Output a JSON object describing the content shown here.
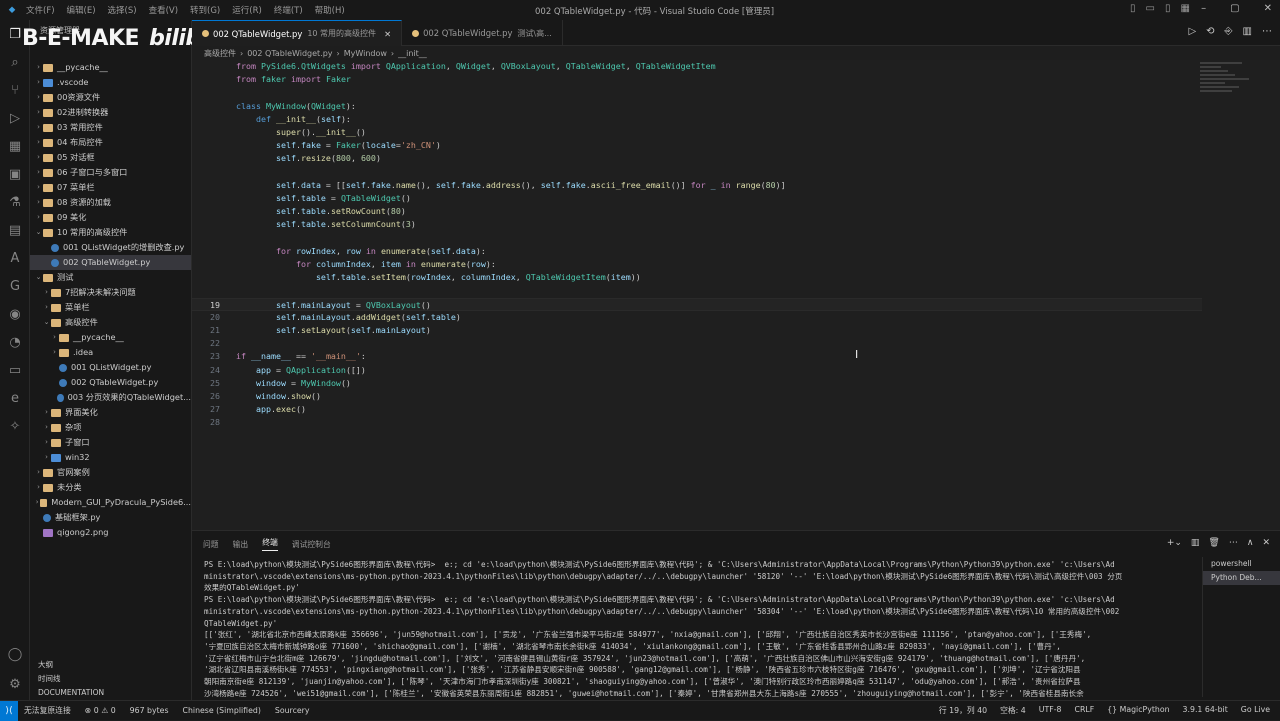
{
  "titlebar": {
    "menu": [
      "文件(F)",
      "编辑(E)",
      "选择(S)",
      "查看(V)",
      "转到(G)",
      "运行(R)",
      "终端(T)",
      "帮助(H)"
    ],
    "title": "002 QTableWidget.py - 代码 - Visual Studio Code [管理员]"
  },
  "watermark": {
    "text": "B-E-MAKE",
    "logo": "bilibili"
  },
  "sidebar": {
    "header": "资源管理器",
    "items": [
      {
        "label": "__pycache__",
        "icon": "folder",
        "depth": 1,
        "chev": "›"
      },
      {
        "label": ".vscode",
        "icon": "folder-blue",
        "depth": 1,
        "chev": "›"
      },
      {
        "label": "00资源文件",
        "icon": "folder",
        "depth": 1,
        "chev": "›"
      },
      {
        "label": "02进制转换器",
        "icon": "folder",
        "depth": 1,
        "chev": "›"
      },
      {
        "label": "03 常用控件",
        "icon": "folder",
        "depth": 1,
        "chev": "›"
      },
      {
        "label": "04 布局控件",
        "icon": "folder",
        "depth": 1,
        "chev": "›"
      },
      {
        "label": "05 对话框",
        "icon": "folder",
        "depth": 1,
        "chev": "›"
      },
      {
        "label": "06 子窗口与多窗口",
        "icon": "folder",
        "depth": 1,
        "chev": "›"
      },
      {
        "label": "07 菜单栏",
        "icon": "folder",
        "depth": 1,
        "chev": "›"
      },
      {
        "label": "08 资源的加载",
        "icon": "folder",
        "depth": 1,
        "chev": "›"
      },
      {
        "label": "09 美化",
        "icon": "folder",
        "depth": 1,
        "chev": "›"
      },
      {
        "label": "10 常用的高级控件",
        "icon": "folder",
        "depth": 1,
        "chev": "⌄"
      },
      {
        "label": "001 QListWidget的增删改查.py",
        "icon": "py",
        "depth": 2,
        "chev": ""
      },
      {
        "label": "002 QTableWidget.py",
        "icon": "py",
        "depth": 2,
        "chev": "",
        "selected": true
      },
      {
        "label": "测试",
        "icon": "folder",
        "depth": 1,
        "chev": "⌄"
      },
      {
        "label": "7招解决未解决问题",
        "icon": "folder",
        "depth": 2,
        "chev": "›"
      },
      {
        "label": "菜单栏",
        "icon": "folder",
        "depth": 2,
        "chev": "›"
      },
      {
        "label": "高级控件",
        "icon": "folder",
        "depth": 2,
        "chev": "⌄"
      },
      {
        "label": "__pycache__",
        "icon": "folder",
        "depth": 3,
        "chev": "›"
      },
      {
        "label": ".idea",
        "icon": "folder",
        "depth": 3,
        "chev": "›"
      },
      {
        "label": "001 QListWidget.py",
        "icon": "py",
        "depth": 3,
        "chev": ""
      },
      {
        "label": "002 QTableWidget.py",
        "icon": "py",
        "depth": 3,
        "chev": ""
      },
      {
        "label": "003 分页效果的QTableWidget...",
        "icon": "py",
        "depth": 3,
        "chev": ""
      },
      {
        "label": "界面美化",
        "icon": "folder",
        "depth": 2,
        "chev": "›"
      },
      {
        "label": "杂项",
        "icon": "folder",
        "depth": 2,
        "chev": "›"
      },
      {
        "label": "子窗口",
        "icon": "folder",
        "depth": 2,
        "chev": "›"
      },
      {
        "label": "win32",
        "icon": "folder-blue",
        "depth": 2,
        "chev": "›"
      },
      {
        "label": "官网案例",
        "icon": "folder",
        "depth": 1,
        "chev": "›"
      },
      {
        "label": "未分类",
        "icon": "folder",
        "depth": 1,
        "chev": "›"
      },
      {
        "label": "Modern_GUI_PyDracula_PySide6...",
        "icon": "folder",
        "depth": 1,
        "chev": "›"
      },
      {
        "label": "基础框架.py",
        "icon": "py",
        "depth": 1,
        "chev": ""
      },
      {
        "label": "qigong2.png",
        "icon": "png",
        "depth": 1,
        "chev": ""
      }
    ],
    "bottom": [
      "大纲",
      "时间线",
      "DOCUMENTATION"
    ]
  },
  "tabs": [
    {
      "label": "002 QTableWidget.py",
      "sub": "10 常用的高级控件",
      "active": true
    },
    {
      "label": "002 QTableWidget.py",
      "sub": "测试\\高...",
      "active": false
    }
  ],
  "breadcrumb": [
    "高级控件",
    "002 QTableWidget.py",
    "MyWindow",
    "__init__"
  ],
  "code": [
    {
      "n": "",
      "html": "<span class='kw'>from</span> <span class='cls'>PySide6.QtWidgets</span> <span class='kw'>import</span> <span class='cls'>QApplication</span>, <span class='cls'>QWidget</span>, <span class='cls'>QVBoxLayout</span>, <span class='cls'>QTableWidget</span>, <span class='cls'>QTableWidgetItem</span>"
    },
    {
      "n": "",
      "html": "<span class='kw'>from</span> <span class='cls'>faker</span> <span class='kw'>import</span> <span class='cls'>Faker</span>"
    },
    {
      "n": "",
      "html": ""
    },
    {
      "n": "",
      "html": "<span class='kw2'>class</span> <span class='cls'>MyWindow</span>(<span class='cls'>QWidget</span>):"
    },
    {
      "n": "",
      "html": "    <span class='kw2'>def</span> <span class='fn'>__init__</span>(<span class='var'>self</span>):"
    },
    {
      "n": "",
      "html": "        <span class='fn'>super</span>().<span class='fn'>__init__</span>()"
    },
    {
      "n": "",
      "html": "        <span class='var'>self</span>.<span class='var'>fake</span> = <span class='cls'>Faker</span>(<span class='var'>locale</span>=<span class='str'>'zh_CN'</span>)"
    },
    {
      "n": "",
      "html": "        <span class='var'>self</span>.<span class='fn'>resize</span>(<span class='num'>800</span>, <span class='num'>600</span>)"
    },
    {
      "n": "",
      "html": ""
    },
    {
      "n": "",
      "html": "        <span class='var'>self</span>.<span class='var'>data</span> = [[<span class='var'>self</span>.<span class='var'>fake</span>.<span class='fn'>name</span>(), <span class='var'>self</span>.<span class='var'>fake</span>.<span class='fn'>address</span>(), <span class='var'>self</span>.<span class='var'>fake</span>.<span class='fn'>ascii_free_email</span>()] <span class='kw'>for</span> <span class='var'>_</span> <span class='kw'>in</span> <span class='fn'>range</span>(<span class='num'>80</span>)]"
    },
    {
      "n": "",
      "html": "        <span class='var'>self</span>.<span class='var'>table</span> = <span class='cls'>QTableWidget</span>()"
    },
    {
      "n": "",
      "html": "        <span class='var'>self</span>.<span class='var'>table</span>.<span class='fn'>setRowCount</span>(<span class='num'>80</span>)"
    },
    {
      "n": "",
      "html": "        <span class='var'>self</span>.<span class='var'>table</span>.<span class='fn'>setColumnCount</span>(<span class='num'>3</span>)"
    },
    {
      "n": "",
      "html": ""
    },
    {
      "n": "",
      "html": "        <span class='kw'>for</span> <span class='var'>rowIndex</span>, <span class='var'>row</span> <span class='kw'>in</span> <span class='fn'>enumerate</span>(<span class='var'>self</span>.<span class='var'>data</span>):"
    },
    {
      "n": "",
      "html": "            <span class='kw'>for</span> <span class='var'>columnIndex</span>, <span class='var'>item</span> <span class='kw'>in</span> <span class='fn'>enumerate</span>(<span class='var'>row</span>):"
    },
    {
      "n": "",
      "html": "                <span class='var'>self</span>.<span class='var'>table</span>.<span class='fn'>setItem</span>(<span class='var'>rowIndex</span>, <span class='var'>columnIndex</span>, <span class='cls'>QTableWidgetItem</span>(<span class='var'>item</span>))"
    },
    {
      "n": "",
      "html": ""
    },
    {
      "n": "19",
      "html": "        <span class='var'>self</span>.<span class='var'>mainLayout</span> = <span class='cls'>QVBoxLayout</span>()",
      "cur": true
    },
    {
      "n": "20",
      "html": "        <span class='var'>self</span>.<span class='var'>mainLayout</span>.<span class='fn'>addWidget</span>(<span class='var'>self</span>.<span class='var'>table</span>)"
    },
    {
      "n": "21",
      "html": "        <span class='var'>self</span>.<span class='fn'>setLayout</span>(<span class='var'>self</span>.<span class='var'>mainLayout</span>)"
    },
    {
      "n": "22",
      "html": ""
    },
    {
      "n": "23",
      "html": "<span class='kw'>if</span> <span class='var'>__name__</span> == <span class='str'>'__main__'</span>:"
    },
    {
      "n": "24",
      "html": "    <span class='var'>app</span> = <span class='cls'>QApplication</span>([])"
    },
    {
      "n": "25",
      "html": "    <span class='var'>window</span> = <span class='cls'>MyWindow</span>()"
    },
    {
      "n": "26",
      "html": "    <span class='var'>window</span>.<span class='fn'>show</span>()"
    },
    {
      "n": "27",
      "html": "    <span class='var'>app</span>.<span class='fn'>exec</span>()"
    },
    {
      "n": "28",
      "html": ""
    }
  ],
  "panel": {
    "tabs": [
      "问题",
      "输出",
      "终端",
      "调试控制台"
    ],
    "active": "终端",
    "terminal": [
      "PS E:\\load\\python\\模块测试\\PySide6图形界面库\\教程\\代码>  e:; cd 'e:\\load\\python\\模块测试\\PySide6图形界面库\\教程\\代码'; & 'C:\\Users\\Administrator\\AppData\\Local\\Programs\\Python\\Python39\\python.exe' 'c:\\Users\\Ad",
      "ministrator\\.vscode\\extensions\\ms-python.python-2023.4.1\\pythonFiles\\lib\\python\\debugpy\\adapter/../..\\debugpy\\launcher' '58120' '--' 'E:\\load\\python\\模块测试\\PySide6图形界面库\\教程\\代码\\测试\\高级控件\\003 分页",
      "效果的QTableWidget.py'",
      "PS E:\\load\\python\\模块测试\\PySide6图形界面库\\教程\\代码>  e:; cd 'e:\\load\\python\\模块测试\\PySide6图形界面库\\教程\\代码'; & 'C:\\Users\\Administrator\\AppData\\Local\\Programs\\Python\\Python39\\python.exe' 'c:\\Users\\Ad",
      "ministrator\\.vscode\\extensions\\ms-python.python-2023.4.1\\pythonFiles\\lib\\python\\debugpy\\adapter/../..\\debugpy\\launcher' '58304' '--' 'E:\\load\\python\\模块测试\\PySide6图形界面库\\教程\\代码\\10 常用的高级控件\\002",
      "QTableWidget.py'",
      "[['张红', '湖北省北京市西峰太原路k座 356696', 'jun59@hotmail.com'], ['贡龙', '广东省兰强市梁平马街z座 584977', 'nxia@gmail.com'], ['邱翔', '广西壮族自治区秀英市长沙宫街e座 111156', 'ptan@yahoo.com'], ['王秀梅',",
      "'宁夏回族自治区太梅市新城钟路o座 771600', 'shichao@gmail.com'], ['谢楠', '湖北省琴市南长余街k座 414034', 'xiulankong@gmail.com'], ['王敏', '广东省桂香县郢州合山路z座 829833', 'nayi@gmail.com'], ['曹丹',",
      "'辽宁省红梅市山宁台北街m座 126679', 'jingdu@hotmail.com'], ['刘文', '河南省健县锡山黄街r座 357924', 'jun23@hotmail.com'], ['高萌', '广西壮族自治区佛山市山兴海安街g座 924179', 'thuang@hotmail.com'], ['唐丹丹',",
      "'湖北省辽阳县南溪杨街k座 774553', 'pingxiang@hotmail.com'], ['张秀', '江苏省静县安顺宋街n座 900588', 'gang12@gmail.com'], ['杨静', '陕西省五珍市六枝特区街g座 716476', 'gxu@gmail.com'], ['刘坤', '辽宁省沈阳县",
      "朝阳南京街e座 812139', 'juanjin@yahoo.com'], ['陈琴', '天津市海门市孝南深圳街y座 300821', 'shaoguiying@yahoo.com'], ['曾淑华', '澳门特别行政区玲市西丽婷路q座 531147', 'odu@yahoo.com'], ['郝浩', '贵州省拉萨县",
      "沙湾杨路e座 724526', 'wei51@gmail.com'], ['陈桂兰', '安徽省英荣县东丽周街i座 882851', 'guwei@hotmail.com'], ['秦婷', '甘肃省郑州县大东上海路s座 270555', 'zhouguiying@hotmail.com'], ['彭宁', '陕西省桂县南长余"
    ],
    "terminals": [
      "powershell",
      "Python Deb..."
    ]
  },
  "status": {
    "left": [
      "无法复原连接",
      "⊗ 0 ⚠ 0",
      "967 bytes",
      "Chinese (Simplified)",
      "Sourcery"
    ],
    "right": [
      "行 19，列 40",
      "空格: 4",
      "UTF-8",
      "CRLF",
      "{} MagicPython",
      "3.9.1 64-bit",
      "Go Live"
    ]
  }
}
